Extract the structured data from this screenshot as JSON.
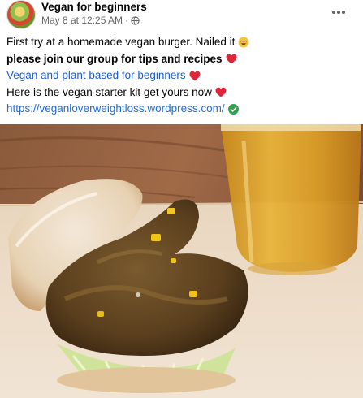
{
  "post": {
    "author": "Vegan for beginners",
    "timestamp": "May 8 at 12:25 AM",
    "separator": "·",
    "privacy_icon": "globe-icon",
    "more_icon": "more-horizontal-icon",
    "lines": {
      "line1": "First try at a homemade vegan burger. Nailed it",
      "line2": "please join our group for tips and recipes",
      "line3": "Vegan and plant based for beginners",
      "line4": "Here is the vegan starter kit get yours now",
      "line5": "https://veganloverweightloss.wordpress.com/"
    },
    "emoji": {
      "smile": "smiling-face-icon",
      "heart": "red-heart-icon",
      "check": "green-check-icon"
    }
  },
  "colors": {
    "text": "#050505",
    "secondary": "#65676b",
    "link": "#216fdb",
    "heart": "#e0243a",
    "check": "#31a24c"
  }
}
